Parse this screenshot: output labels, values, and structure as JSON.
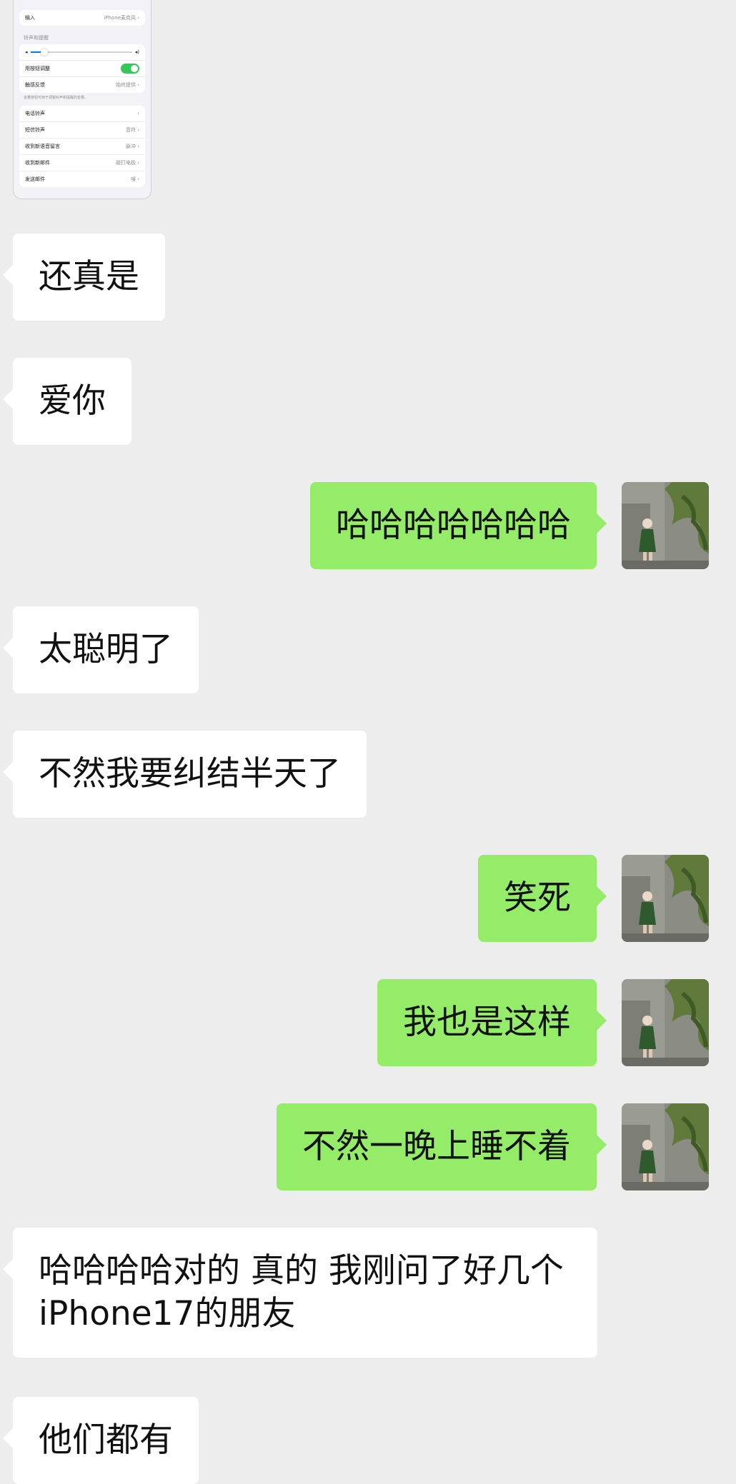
{
  "settings_preview": {
    "input_row": {
      "label": "输入",
      "value": "iPhone麦克风"
    },
    "section_header": "铃声和提醒",
    "toggle_label": "用按钮调整",
    "haptics": {
      "label": "触感反馈",
      "value": "始终提供"
    },
    "note": "音量按钮可用于调整铃声和提醒的音量。",
    "rows": [
      {
        "label": "电话铃声",
        "value": ""
      },
      {
        "label": "短信铃声",
        "value": "音符"
      },
      {
        "label": "收到新语音留言",
        "value": "脉冲"
      },
      {
        "label": "收到新邮件",
        "value": "敲打电极"
      },
      {
        "label": "发送邮件",
        "value": "嗖"
      }
    ],
    "volume_low_icon": "speaker-low-icon",
    "volume_high_icon": "speaker-high-icon"
  },
  "messages": [
    {
      "side": "left",
      "text": "还真是"
    },
    {
      "side": "left",
      "text": "爱你"
    },
    {
      "side": "right",
      "text": "哈哈哈哈哈哈哈"
    },
    {
      "side": "left",
      "text": "太聪明了"
    },
    {
      "side": "left",
      "text": "不然我要纠结半天了"
    },
    {
      "side": "right",
      "text": "笑死"
    },
    {
      "side": "right",
      "text": "我也是这样"
    },
    {
      "side": "right",
      "text": "不然一晚上睡不着"
    },
    {
      "side": "left",
      "text": "哈哈哈哈对的 真的  我刚问了好几个iPhone17的朋友"
    },
    {
      "side": "left",
      "text": "他们都有"
    }
  ],
  "colors": {
    "background": "#ededed",
    "incoming_bubble": "#ffffff",
    "outgoing_bubble": "#95ec69",
    "toggle_on": "#34c759"
  }
}
